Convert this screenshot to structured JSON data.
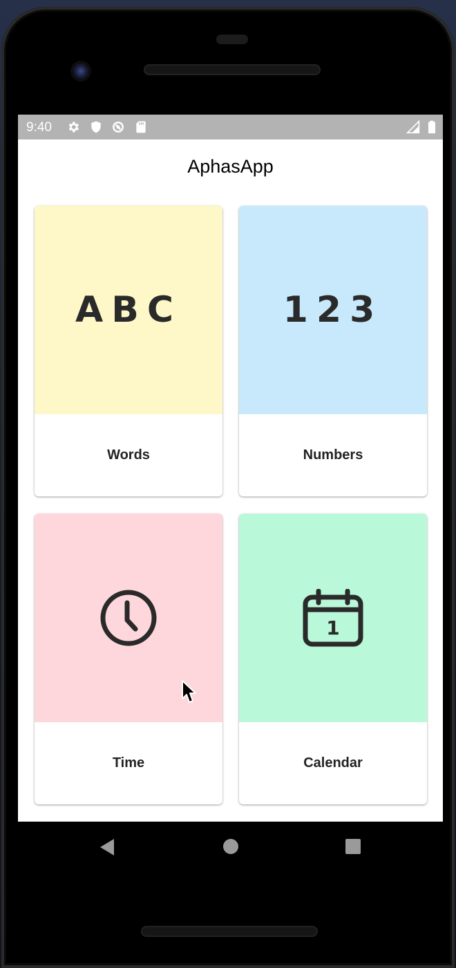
{
  "status_bar": {
    "time": "9:40",
    "icons": [
      "gear-icon",
      "shield-icon",
      "data-saver-icon",
      "sd-card-icon"
    ],
    "right_icons": [
      "signal-icon",
      "battery-icon"
    ]
  },
  "app": {
    "title": "AphasApp"
  },
  "cards": [
    {
      "label": "Words",
      "glyph": "ABC",
      "color": "#fef8c8",
      "icon": "abc-letters-icon"
    },
    {
      "label": "Numbers",
      "glyph": "123",
      "color": "#c7e9fb",
      "icon": "numbers-123-icon"
    },
    {
      "label": "Time",
      "glyph": "",
      "color": "#fed7dc",
      "icon": "clock-icon"
    },
    {
      "label": "Calendar",
      "glyph": "1",
      "color": "#b9f9d9",
      "icon": "calendar-icon"
    }
  ],
  "nav": {
    "buttons": [
      "back-icon",
      "home-icon",
      "recents-icon"
    ]
  }
}
